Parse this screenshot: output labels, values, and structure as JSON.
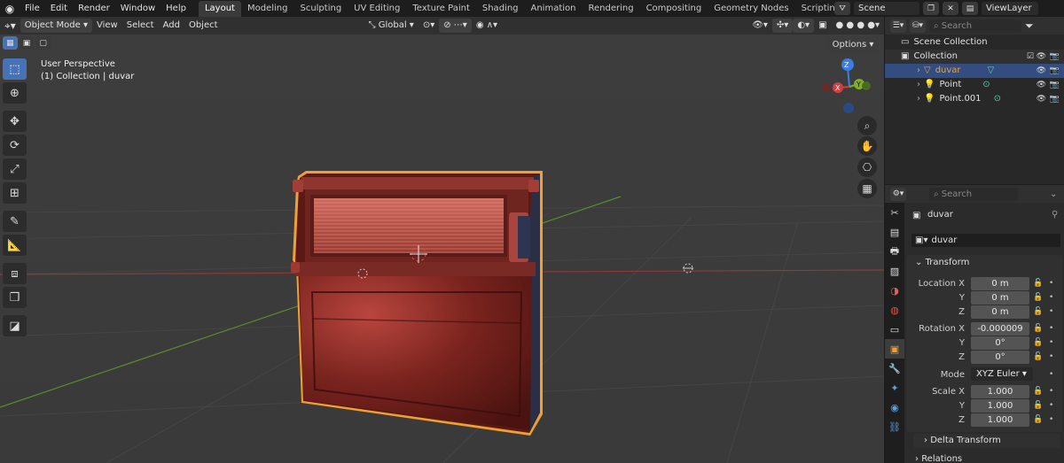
{
  "menu": [
    "File",
    "Edit",
    "Render",
    "Window",
    "Help"
  ],
  "workspaces": [
    "Layout",
    "Modeling",
    "Sculpting",
    "UV Editing",
    "Texture Paint",
    "Shading",
    "Animation",
    "Rendering",
    "Compositing",
    "Geometry Nodes",
    "Scripting",
    "+"
  ],
  "scene": {
    "name": "Scene",
    "view_layer": "ViewLayer"
  },
  "viewport": {
    "mode": "Object Mode",
    "menus": [
      "View",
      "Select",
      "Add",
      "Object"
    ],
    "orientation": "Global",
    "options": "Options",
    "perspective": "User Perspective",
    "collection_info": "(1) Collection | duvar",
    "gizmo": {
      "x": "X",
      "y": "Y",
      "z": "Z"
    }
  },
  "outliner": {
    "search_placeholder": "Search",
    "root": "Scene Collection",
    "collection": "Collection",
    "items": [
      "duvar",
      "Point",
      "Point.001"
    ]
  },
  "properties": {
    "search_placeholder": "Search",
    "object_name": "duvar",
    "data_name": "duvar",
    "transform_title": "Transform",
    "location_label": "Location X",
    "loc_x": "0 m",
    "loc_y": "0 m",
    "loc_z": "0 m",
    "rotation_label": "Rotation X",
    "rot_x": "-0.000009",
    "rot_y": "0°",
    "rot_z": "0°",
    "mode_label": "Mode",
    "mode_value": "XYZ Euler",
    "scale_label": "Scale X",
    "scale_x": "1.000",
    "scale_y": "1.000",
    "scale_z": "1.000",
    "y": "Y",
    "z": "Z",
    "delta_title": "Delta Transform",
    "relations_title": "Relations"
  },
  "colors": {
    "accent": "#4772b3",
    "selection_outline": "#f0a030",
    "object_red": "#8a2a24"
  }
}
